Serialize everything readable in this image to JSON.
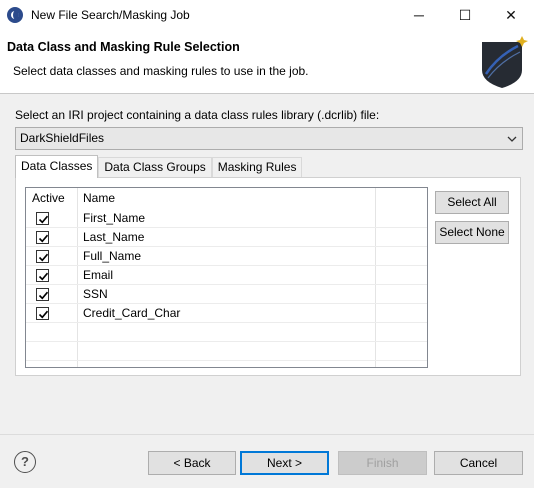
{
  "window": {
    "title": "New File Search/Masking Job",
    "minimize_glyph": "─",
    "maximize_glyph": "☐",
    "close_glyph": "✕"
  },
  "header": {
    "title": "Data Class and Masking Rule Selection",
    "description": "Select data classes and masking rules to use in the job."
  },
  "project": {
    "label": "Select an IRI project containing a data class rules library (.dcrlib) file:",
    "selected": "DarkShieldFiles"
  },
  "tabs": [
    {
      "label": "Data Classes",
      "active": true
    },
    {
      "label": "Data Class Groups",
      "active": false
    },
    {
      "label": "Masking Rules",
      "active": false
    }
  ],
  "table": {
    "columns": [
      "Active",
      "Name"
    ],
    "rows": [
      {
        "active": true,
        "name": "First_Name"
      },
      {
        "active": true,
        "name": "Last_Name"
      },
      {
        "active": true,
        "name": "Full_Name"
      },
      {
        "active": true,
        "name": "Email"
      },
      {
        "active": true,
        "name": "SSN"
      },
      {
        "active": true,
        "name": "Credit_Card_Char"
      }
    ]
  },
  "side_buttons": {
    "select_all": "Select All",
    "select_none": "Select None"
  },
  "footer": {
    "help_glyph": "?",
    "back": "< Back",
    "next": "Next >",
    "finish": "Finish",
    "cancel": "Cancel"
  },
  "icons": {
    "app": "eclipse-icon",
    "header_logo": "shield-logo-icon",
    "dropdown": "chevron-down-icon",
    "help": "help-icon"
  }
}
